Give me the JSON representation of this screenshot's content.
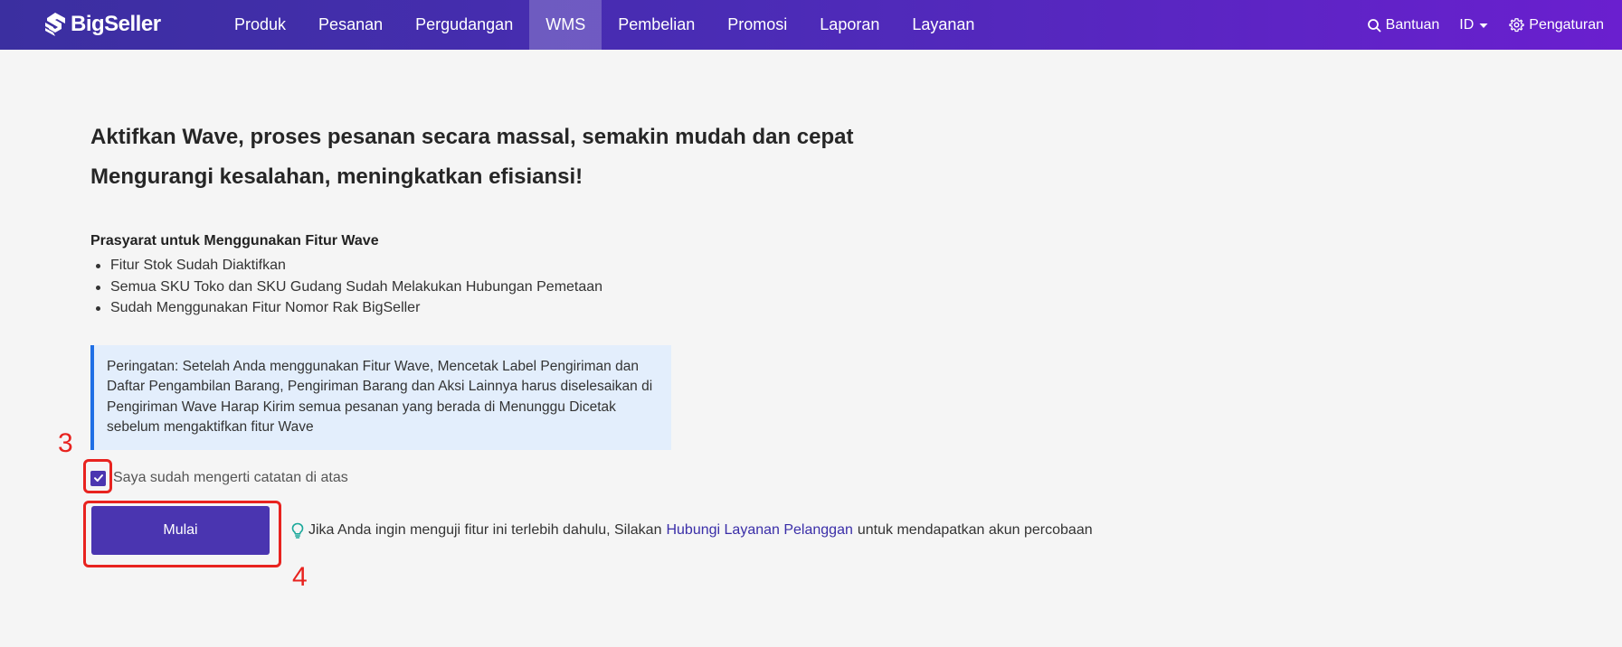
{
  "brand": {
    "name": "BigSeller"
  },
  "nav": {
    "items": [
      {
        "label": "Produk",
        "active": false
      },
      {
        "label": "Pesanan",
        "active": false
      },
      {
        "label": "Pergudangan",
        "active": false
      },
      {
        "label": "WMS",
        "active": true
      },
      {
        "label": "Pembelian",
        "active": false
      },
      {
        "label": "Promosi",
        "active": false
      },
      {
        "label": "Laporan",
        "active": false
      },
      {
        "label": "Layanan",
        "active": false
      }
    ]
  },
  "tools": {
    "help_label": "Bantuan",
    "lang_label": "ID",
    "settings_label": "Pengaturan"
  },
  "main": {
    "headline_1": "Aktifkan Wave, proses pesanan secara massal, semakin mudah dan cepat",
    "headline_2": "Mengurangi kesalahan, meningkatkan efisiansi!",
    "prereq_title": "Prasyarat untuk Menggunakan Fitur Wave",
    "prereqs": [
      "Fitur Stok Sudah Diaktifkan",
      "Semua SKU Toko dan SKU Gudang Sudah Melakukan Hubungan Pemetaan",
      "Sudah Menggunakan Fitur Nomor Rak BigSeller"
    ],
    "warning": "Peringatan: Setelah Anda menggunakan Fitur Wave, Mencetak Label Pengiriman dan Daftar Pengambilan Barang, Pengiriman Barang dan Aksi Lainnya harus diselesaikan di Pengiriman Wave Harap Kirim semua pesanan yang berada di Menunggu Dicetak sebelum mengaktifkan fitur Wave",
    "agree_label": "Saya sudah mengerti catatan di atas",
    "agree_checked": true,
    "start_label": "Mulai",
    "hint_before": "Jika Anda ingin menguji fitur ini terlebih dahulu, Silakan",
    "hint_link": "Hubungi Layanan Pelanggan",
    "hint_after": "untuk mendapatkan akun percobaan"
  },
  "annotations": {
    "step_3": "3",
    "step_4": "4"
  },
  "colors": {
    "accent": "#4a35b0",
    "warning_border": "#1f6fe5",
    "annotation": "#e8231f",
    "hint_icon": "#1aa89a"
  }
}
